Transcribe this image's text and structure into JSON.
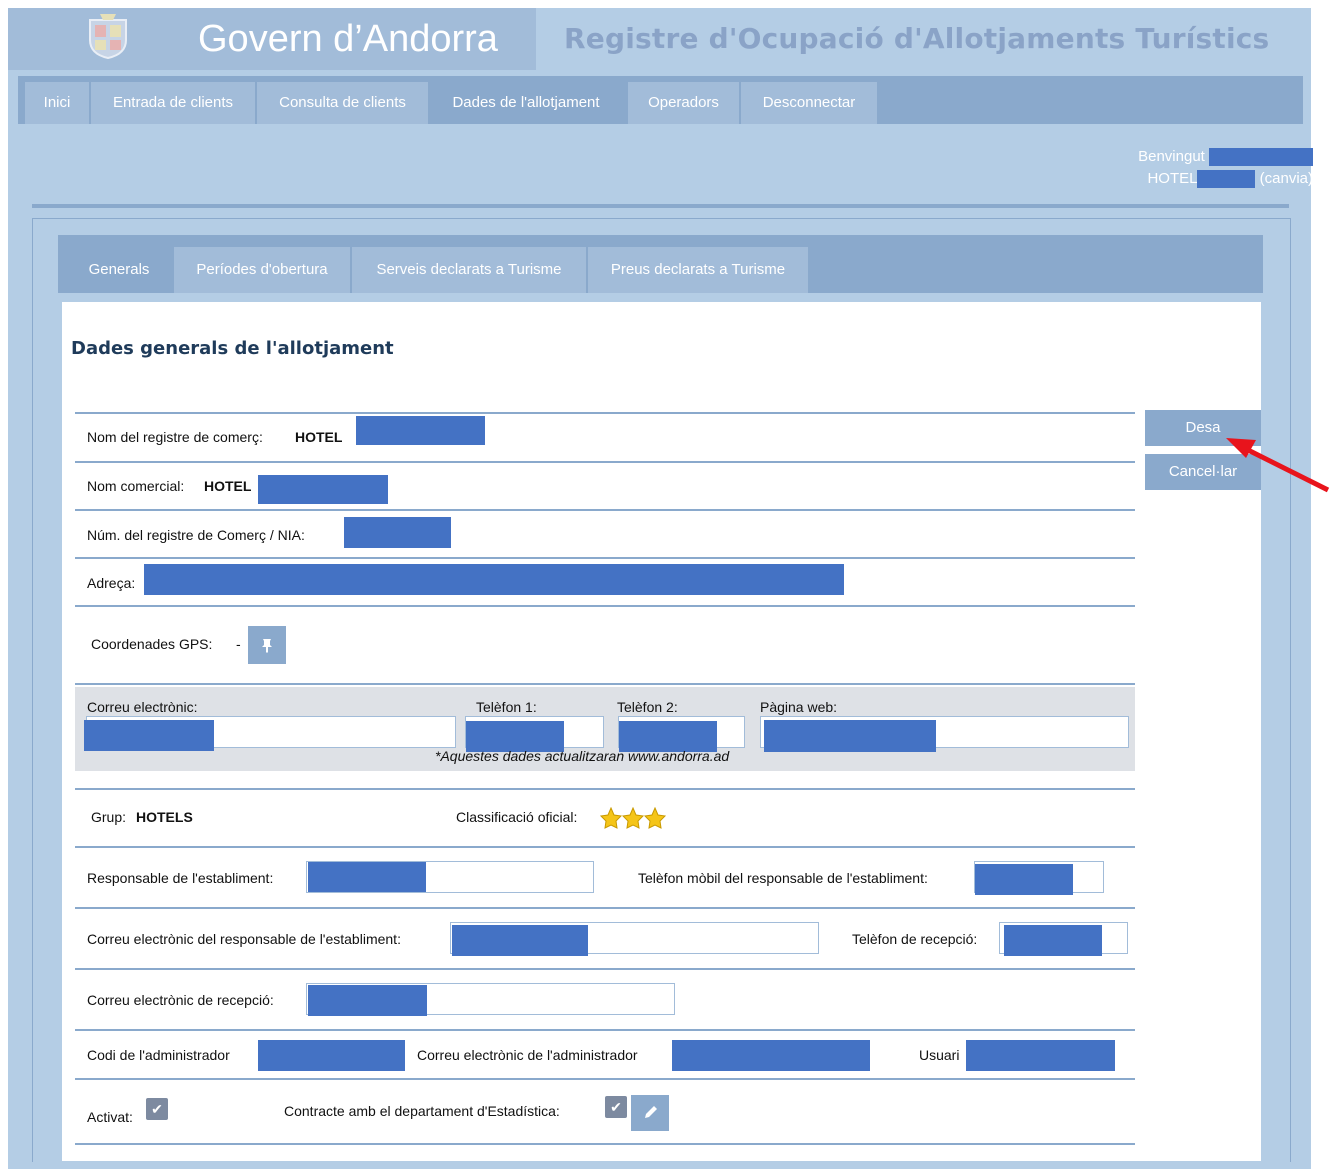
{
  "header": {
    "brand": "Govern d’Andorra",
    "app_title": "Registre d'Ocupació d'Allotjaments Turístics",
    "logo_icon": "andorra-coat-of-arms-icon"
  },
  "main_nav": {
    "tabs": [
      {
        "label": "Inici"
      },
      {
        "label": "Entrada de clients"
      },
      {
        "label": "Consulta de clients"
      },
      {
        "label": "Dades de l'allotjament",
        "active": true
      },
      {
        "label": "Operadors"
      },
      {
        "label": "Desconnectar"
      }
    ]
  },
  "welcome": {
    "greeting": "Benvingut",
    "hotel_prefix": "HOTEL",
    "change_link": "(canvia)"
  },
  "sub_nav": {
    "tabs": [
      {
        "label": "Generals",
        "active": true
      },
      {
        "label": "Períodes d'obertura"
      },
      {
        "label": "Serveis declarats a Turisme"
      },
      {
        "label": "Preus declarats a Turisme"
      }
    ]
  },
  "form": {
    "title": "Dades generals de l'allotjament",
    "registry_name_label": "Nom del registre de comerç:",
    "registry_name_value": "HOTEL",
    "commercial_name_label": "Nom comercial:",
    "commercial_name_value": "HOTEL",
    "nia_label": "Núm. del registre de Comerç / NIA:",
    "address_label": "Adreça:",
    "gps_label": "Coordenades GPS:",
    "gps_value": "-",
    "gps_icon": "pin-icon",
    "email_label": "Correu electrònic:",
    "phone1_label": "Telèfon 1:",
    "phone2_label": "Telèfon 2:",
    "web_label": "Pàgina web:",
    "web_note": "*Aquestes dades actualitzaran www.andorra.ad",
    "group_label": "Grup:",
    "group_value": "HOTELS",
    "classification_label": "Classificació oficial:",
    "stars": 3,
    "manager_label": "Responsable de l'establiment:",
    "manager_mobile_label": "Telèfon mòbil del responsable de l'establiment:",
    "manager_email_label": "Correu electrònic del responsable de l'establiment:",
    "reception_phone_label": "Telèfon de recepció:",
    "reception_email_label": "Correu electrònic de recepció:",
    "admin_code_label": "Codi de l'administrador",
    "admin_email_label": "Correu electrònic de l'administrador",
    "user_label": "Usuari",
    "activated_label": "Activat:",
    "contract_label": "Contracte amb el departament d'Estadística:",
    "edit_icon": "pencil-icon"
  },
  "actions": {
    "save_label": "Desa",
    "cancel_label": "Cancel·lar"
  },
  "colors": {
    "background": "#b4cde5",
    "nav": "#8aa9cc",
    "redaction": "#4472c4",
    "annotation_arrow": "#e8141c"
  }
}
